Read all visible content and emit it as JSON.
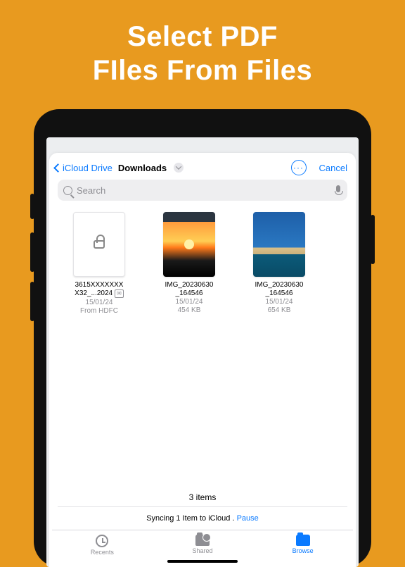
{
  "promo": {
    "line1": "Select PDF",
    "line2": "FIles From Files"
  },
  "nav": {
    "back_label": "iCloud Drive",
    "title": "Downloads",
    "cancel_label": "Cancel"
  },
  "search": {
    "placeholder": "Search"
  },
  "files": [
    {
      "kind": "doc",
      "name_line1": "3615XXXXXXX",
      "name_line2": "X32_...2024",
      "badge": "✉",
      "date": "15/01/24",
      "meta": "From HDFC"
    },
    {
      "kind": "sunset",
      "name_line1": "IMG_20230630",
      "name_line2": "_164546",
      "date": "15/01/24",
      "meta": "454 KB"
    },
    {
      "kind": "beach",
      "name_line1": "IMG_20230630",
      "name_line2": "_164546",
      "date": "15/01/24",
      "meta": "654 KB"
    }
  ],
  "footer": {
    "count": "3 items",
    "sync_text": "Syncing 1 Item to iCloud .",
    "pause_label": "Pause"
  },
  "tabs": {
    "recents": "Recents",
    "shared": "Shared",
    "browse": "Browse"
  }
}
